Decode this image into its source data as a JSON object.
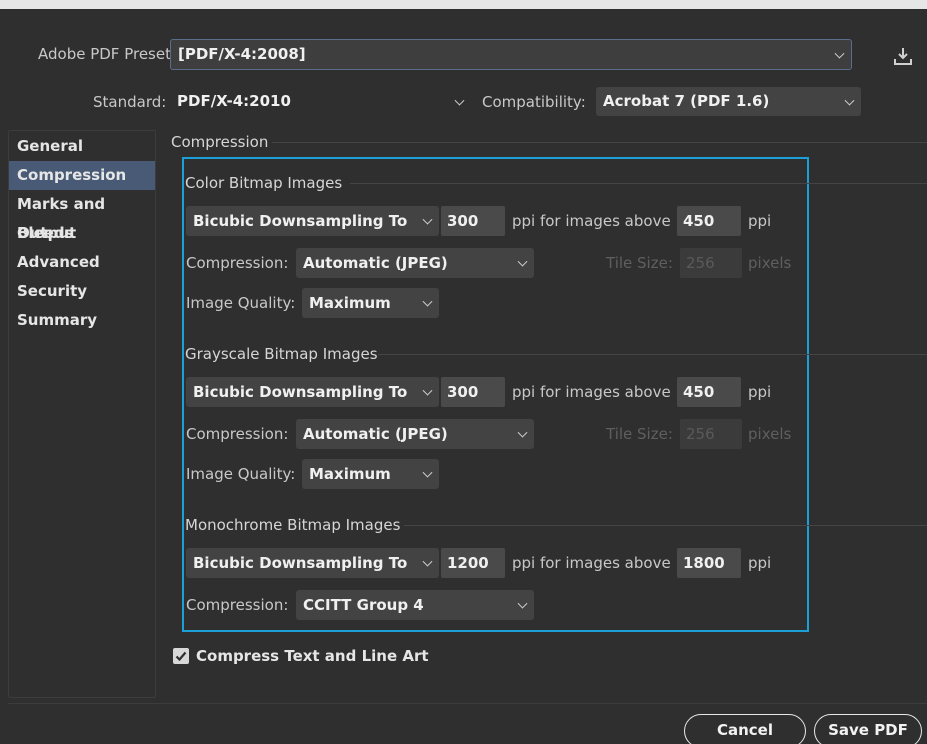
{
  "preset": {
    "label": "Adobe PDF Preset:",
    "value": "[PDF/X-4:2008]"
  },
  "standard": {
    "label": "Standard:",
    "value": "PDF/X-4:2010"
  },
  "compatibility": {
    "label": "Compatibility:",
    "value": "Acrobat 7 (PDF 1.6)"
  },
  "sidebar": {
    "items": [
      {
        "label": "General"
      },
      {
        "label": "Compression"
      },
      {
        "label": "Marks and Bleeds"
      },
      {
        "label": "Output"
      },
      {
        "label": "Advanced"
      },
      {
        "label": "Security"
      },
      {
        "label": "Summary"
      }
    ],
    "selected": "Compression"
  },
  "main": {
    "title": "Compression"
  },
  "color": {
    "title": "Color Bitmap Images",
    "sampling": "Bicubic Downsampling To",
    "ppi": "300",
    "above_label": "ppi for images above",
    "above": "450",
    "ppi_unit": "ppi",
    "compression_label": "Compression:",
    "compression": "Automatic (JPEG)",
    "tile_label": "Tile Size:",
    "tile_value": "256",
    "tile_unit": "pixels",
    "quality_label": "Image Quality:",
    "quality": "Maximum"
  },
  "grayscale": {
    "title": "Grayscale Bitmap Images",
    "sampling": "Bicubic Downsampling To",
    "ppi": "300",
    "above_label": "ppi for images above",
    "above": "450",
    "ppi_unit": "ppi",
    "compression_label": "Compression:",
    "compression": "Automatic (JPEG)",
    "tile_label": "Tile Size:",
    "tile_value": "256",
    "tile_unit": "pixels",
    "quality_label": "Image Quality:",
    "quality": "Maximum"
  },
  "mono": {
    "title": "Monochrome Bitmap Images",
    "sampling": "Bicubic Downsampling To",
    "ppi": "1200",
    "above_label": "ppi for images above",
    "above": "1800",
    "ppi_unit": "ppi",
    "compression_label": "Compression:",
    "compression": "CCITT Group 4"
  },
  "compress_text": {
    "label": "Compress Text and Line Art",
    "checked": true
  },
  "buttons": {
    "cancel": "Cancel",
    "save": "Save PDF"
  },
  "colors": {
    "highlight": "#1a9fd6",
    "selected_bg": "#485a75",
    "bg": "#2f2f2f"
  }
}
